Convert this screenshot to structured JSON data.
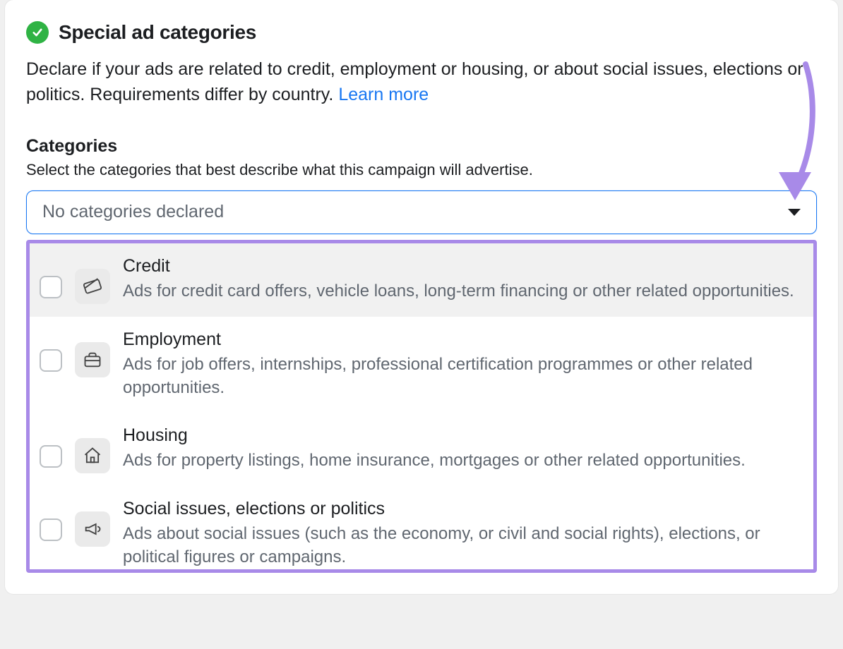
{
  "section": {
    "title": "Special ad categories",
    "description": "Declare if your ads are related to credit, employment or housing, or about social issues, elections or politics. Requirements differ by country. ",
    "learn_more": "Learn more"
  },
  "field": {
    "label": "Categories",
    "help": "Select the categories that best describe what this campaign will advertise.",
    "placeholder": "No categories declared"
  },
  "options": [
    {
      "icon": "credit-card-icon",
      "title": "Credit",
      "desc": "Ads for credit card offers, vehicle loans, long-term financing or other related opportunities."
    },
    {
      "icon": "briefcase-icon",
      "title": "Employment",
      "desc": "Ads for job offers, internships, professional certification programmes or other related opportunities."
    },
    {
      "icon": "home-icon",
      "title": "Housing",
      "desc": "Ads for property listings, home insurance, mortgages or other related opportunities."
    },
    {
      "icon": "megaphone-icon",
      "title": "Social issues, elections or politics",
      "desc": "Ads about social issues (such as the economy, or civil and social rights), elections, or political figures or campaigns."
    }
  ],
  "colors": {
    "accent_purple": "#a88ae8",
    "link_blue": "#1877f2",
    "check_green": "#2fb344"
  }
}
